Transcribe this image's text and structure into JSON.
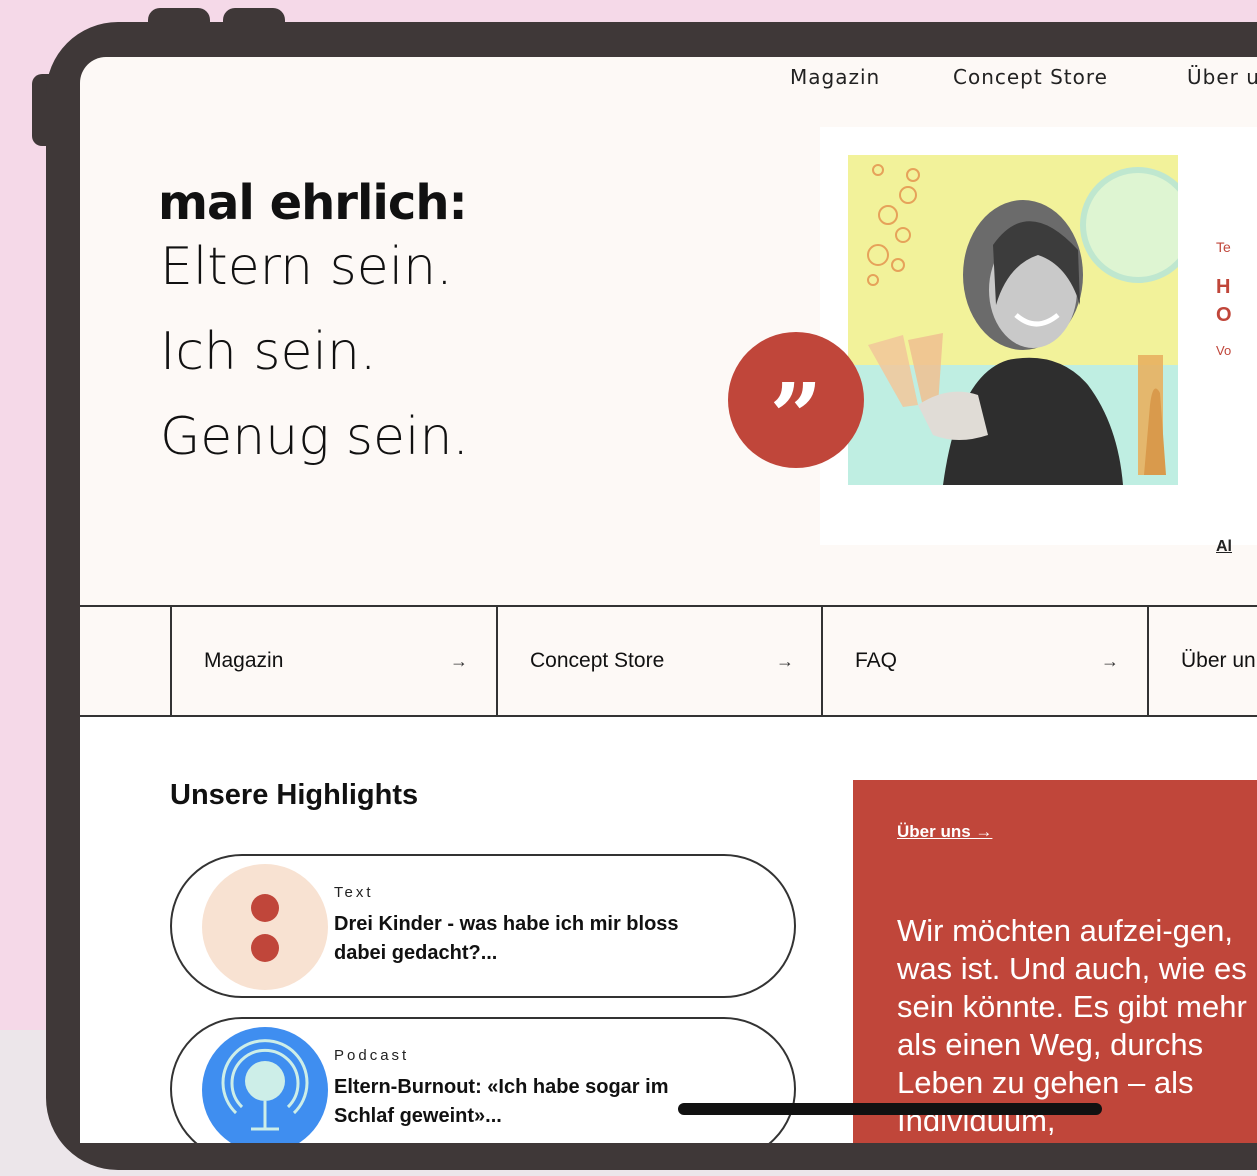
{
  "top_nav": [
    "Magazin",
    "Concept Store",
    "Über uns"
  ],
  "hero": {
    "brand": "mal ehrlich:",
    "lines": [
      "Eltern sein.",
      "Ich sein.",
      "Genug sein."
    ]
  },
  "feature": {
    "quote_glyph": "”",
    "kicker": "Te",
    "title_lines": [
      "H",
      "O"
    ],
    "byline": "Vo",
    "link": "Al"
  },
  "section_nav": [
    {
      "label": "Magazin",
      "arrow": "→"
    },
    {
      "label": "Concept Store",
      "arrow": "→"
    },
    {
      "label": "FAQ",
      "arrow": "→"
    },
    {
      "label": "Über un",
      "arrow": ""
    }
  ],
  "highlights": {
    "heading": "Unsere Highlights",
    "items": [
      {
        "kicker": "Text",
        "title": "Drei Kinder - was habe ich mir bloss dabei gedacht?...",
        "thumb": "colon-dots-icon"
      },
      {
        "kicker": "Podcast",
        "title": "Eltern-Burnout: «Ich habe sogar im Schlaf geweint»...",
        "thumb": "microphone-icon"
      }
    ]
  },
  "about": {
    "link": "Über uns →",
    "text": "Wir möchten aufzei-gen, was ist. Und auch, wie es sein könnte. Es gibt mehr als einen Weg, durchs Leben zu gehen – als Individuum,"
  },
  "colors": {
    "background": "#f5d9e8",
    "device": "#3f3838",
    "accent_red": "#c0463a",
    "cream": "#fdf9f6"
  }
}
